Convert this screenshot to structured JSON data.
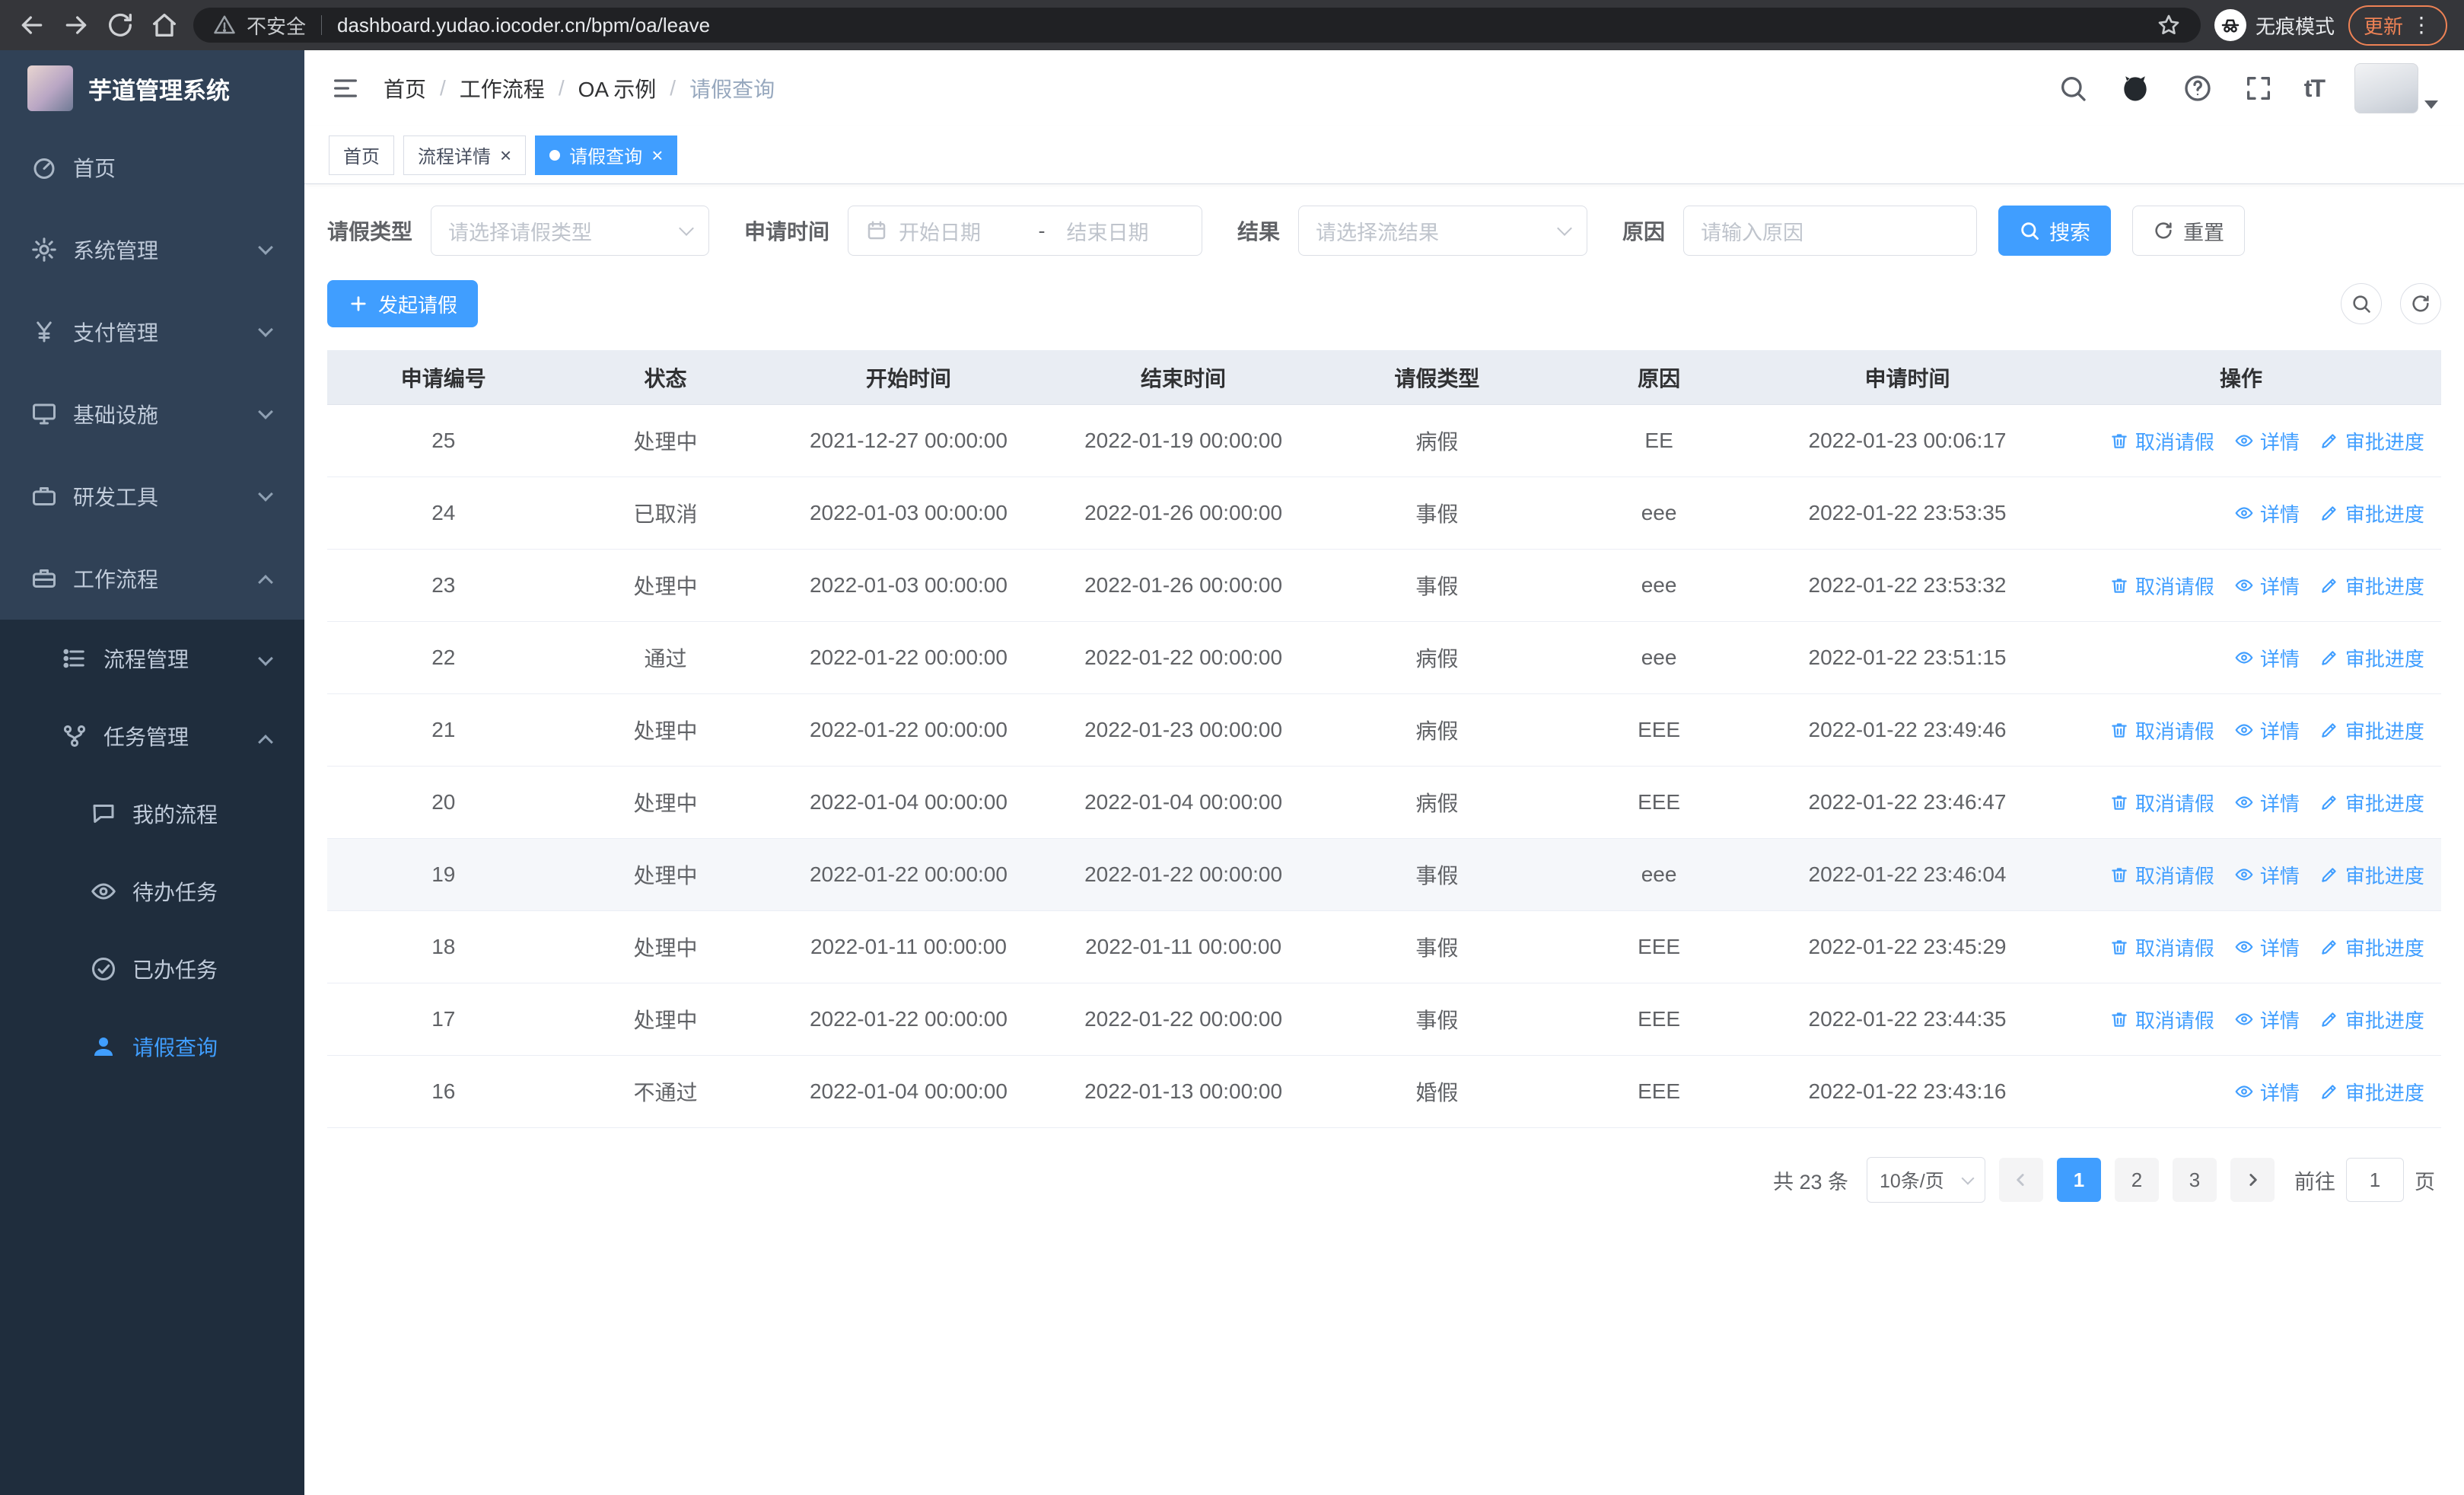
{
  "colors": {
    "accent": "#409eff",
    "sidebar_bg": "#1f2d3d",
    "sidebar_item_bg": "#304156"
  },
  "browser": {
    "security_warning": "不安全",
    "url": "dashboard.yudao.iocoder.cn/bpm/oa/leave",
    "incognito_label": "无痕模式",
    "update_button": "更新"
  },
  "app": {
    "title": "芋道管理系统"
  },
  "sidebar": {
    "items": [
      {
        "name": "home",
        "label": "首页",
        "icon": "dashboard-icon",
        "level": 1
      },
      {
        "name": "system-mgmt",
        "label": "系统管理",
        "icon": "gear-icon",
        "level": 1,
        "chevron": "down"
      },
      {
        "name": "payment-mgmt",
        "label": "支付管理",
        "icon": "yen-icon",
        "level": 1,
        "chevron": "down"
      },
      {
        "name": "infrastructure",
        "label": "基础设施",
        "icon": "monitor-icon",
        "level": 1,
        "chevron": "down"
      },
      {
        "name": "dev-tools",
        "label": "研发工具",
        "icon": "toolbox-icon",
        "level": 1,
        "chevron": "down"
      },
      {
        "name": "workflow",
        "label": "工作流程",
        "icon": "briefcase-icon",
        "level": 1,
        "chevron": "up"
      },
      {
        "name": "process-mgmt",
        "label": "流程管理",
        "icon": "list-icon",
        "level": 2,
        "chevron": "down"
      },
      {
        "name": "task-mgmt",
        "label": "任务管理",
        "icon": "branch-icon",
        "level": 2,
        "chevron": "up"
      },
      {
        "name": "my-process",
        "label": "我的流程",
        "icon": "chat-icon",
        "level": 3
      },
      {
        "name": "todo-tasks",
        "label": "待办任务",
        "icon": "eye-icon",
        "level": 3
      },
      {
        "name": "done-tasks",
        "label": "已办任务",
        "icon": "check-icon",
        "level": 3
      },
      {
        "name": "leave-query",
        "label": "请假查询",
        "icon": "user-icon",
        "level": 3,
        "active": true
      }
    ]
  },
  "breadcrumb": [
    "首页",
    "工作流程",
    "OA 示例",
    "请假查询"
  ],
  "tabs": [
    {
      "label": "首页",
      "active": false,
      "closable": false
    },
    {
      "label": "流程详情",
      "active": false,
      "closable": true
    },
    {
      "label": "请假查询",
      "active": true,
      "closable": true
    }
  ],
  "filters": {
    "leave_type_label": "请假类型",
    "leave_type_placeholder": "请选择请假类型",
    "apply_time_label": "申请时间",
    "start_date_placeholder": "开始日期",
    "date_separator": "-",
    "end_date_placeholder": "结束日期",
    "result_label": "结果",
    "result_placeholder": "请选择流结果",
    "reason_label": "原因",
    "reason_placeholder": "请输入原因",
    "search_button": "搜索",
    "reset_button": "重置"
  },
  "toolbar": {
    "create_button": "发起请假"
  },
  "table": {
    "columns": [
      "申请编号",
      "状态",
      "开始时间",
      "结束时间",
      "请假类型",
      "原因",
      "申请时间",
      "操作"
    ],
    "actions": {
      "cancel": "取消请假",
      "detail": "详情",
      "progress": "审批进度"
    },
    "rows": [
      {
        "id": "25",
        "status": "处理中",
        "start": "2021-12-27 00:00:00",
        "end": "2022-01-19 00:00:00",
        "type": "病假",
        "reason": "EE",
        "applied": "2022-01-23 00:06:17",
        "cancelable": true,
        "hover": false
      },
      {
        "id": "24",
        "status": "已取消",
        "start": "2022-01-03 00:00:00",
        "end": "2022-01-26 00:00:00",
        "type": "事假",
        "reason": "eee",
        "applied": "2022-01-22 23:53:35",
        "cancelable": false,
        "hover": false
      },
      {
        "id": "23",
        "status": "处理中",
        "start": "2022-01-03 00:00:00",
        "end": "2022-01-26 00:00:00",
        "type": "事假",
        "reason": "eee",
        "applied": "2022-01-22 23:53:32",
        "cancelable": true,
        "hover": false
      },
      {
        "id": "22",
        "status": "通过",
        "start": "2022-01-22 00:00:00",
        "end": "2022-01-22 00:00:00",
        "type": "病假",
        "reason": "eee",
        "applied": "2022-01-22 23:51:15",
        "cancelable": false,
        "hover": false
      },
      {
        "id": "21",
        "status": "处理中",
        "start": "2022-01-22 00:00:00",
        "end": "2022-01-23 00:00:00",
        "type": "病假",
        "reason": "EEE",
        "applied": "2022-01-22 23:49:46",
        "cancelable": true,
        "hover": false
      },
      {
        "id": "20",
        "status": "处理中",
        "start": "2022-01-04 00:00:00",
        "end": "2022-01-04 00:00:00",
        "type": "病假",
        "reason": "EEE",
        "applied": "2022-01-22 23:46:47",
        "cancelable": true,
        "hover": false
      },
      {
        "id": "19",
        "status": "处理中",
        "start": "2022-01-22 00:00:00",
        "end": "2022-01-22 00:00:00",
        "type": "事假",
        "reason": "eee",
        "applied": "2022-01-22 23:46:04",
        "cancelable": true,
        "hover": true
      },
      {
        "id": "18",
        "status": "处理中",
        "start": "2022-01-11 00:00:00",
        "end": "2022-01-11 00:00:00",
        "type": "事假",
        "reason": "EEE",
        "applied": "2022-01-22 23:45:29",
        "cancelable": true,
        "hover": false
      },
      {
        "id": "17",
        "status": "处理中",
        "start": "2022-01-22 00:00:00",
        "end": "2022-01-22 00:00:00",
        "type": "事假",
        "reason": "EEE",
        "applied": "2022-01-22 23:44:35",
        "cancelable": true,
        "hover": false
      },
      {
        "id": "16",
        "status": "不通过",
        "start": "2022-01-04 00:00:00",
        "end": "2022-01-13 00:00:00",
        "type": "婚假",
        "reason": "EEE",
        "applied": "2022-01-22 23:43:16",
        "cancelable": false,
        "hover": false
      }
    ]
  },
  "pagination": {
    "total_label": "共 23 条",
    "page_size": "10条/页",
    "pages": [
      "1",
      "2",
      "3"
    ],
    "active_page": "1",
    "goto_label": "前往",
    "goto_value": "1",
    "goto_suffix": "页"
  }
}
